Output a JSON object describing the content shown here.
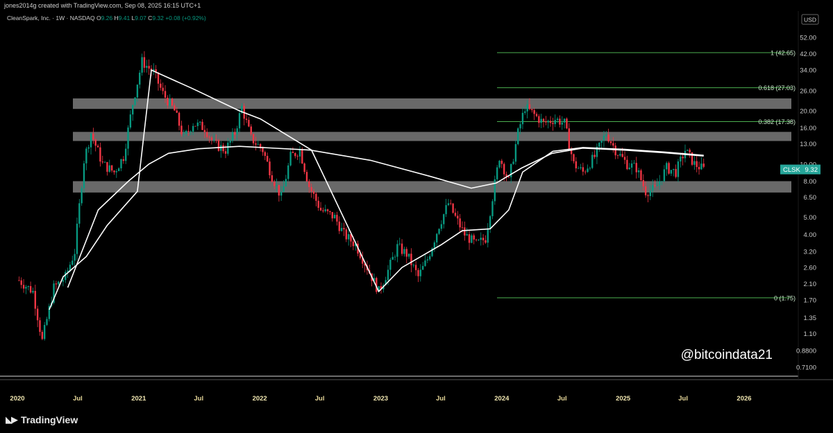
{
  "header": {
    "credit": "jones2014g created with TradingView.com, Sep 08, 2025 16:15 UTC+1"
  },
  "footer": {
    "brand": "TradingView"
  },
  "colors": {
    "up": "#089981",
    "down": "#f23645",
    "fib": "#4caf50",
    "ma": "#ffffff",
    "zone": "#8c8c8c",
    "price_badge": "#26a69a",
    "text": "#c9c9c9"
  },
  "chart_data": {
    "type": "candlestick",
    "symbol_line": "CleanSpark, Inc. · 1W · NASDAQ",
    "ohlc_legend": {
      "o_label": "O",
      "o": "9.26",
      "h_label": "H",
      "h": "9.41",
      "l_label": "L",
      "l": "9.07",
      "c_label": "C",
      "c": "9.32",
      "change": "+0.08 (+0.92%)"
    },
    "currency": "USD",
    "last_price": {
      "ticker": "CLSK",
      "value": "9.32"
    },
    "watermark": "@bitcoindata21",
    "y_scale": "log",
    "ylim": [
      0.66,
      72
    ],
    "y_ticks": [
      "52.00",
      "42.00",
      "34.00",
      "26.00",
      "20.00",
      "16.00",
      "13.00",
      "10.00",
      "8.00",
      "6.50",
      "5.00",
      "4.00",
      "3.20",
      "2.60",
      "2.10",
      "1.70",
      "1.35",
      "1.10",
      "0.8800",
      "0.7100"
    ],
    "x_ticks": [
      "2020",
      "Jul",
      "2021",
      "Jul",
      "2022",
      "Jul",
      "2023",
      "Jul",
      "2024",
      "Jul",
      "2025",
      "Jul",
      "2026"
    ],
    "fib_levels": [
      {
        "label": "1 (42.65)",
        "value": 42.65
      },
      {
        "label": "0.618 (27.03)",
        "value": 27.03
      },
      {
        "label": "0.382 (17.38)",
        "value": 17.38
      },
      {
        "label": "0 (1.75)",
        "value": 1.75
      }
    ],
    "zones": [
      {
        "low": 20.5,
        "high": 23.5
      },
      {
        "low": 13.5,
        "high": 15.2
      },
      {
        "low": 6.9,
        "high": 8.0
      }
    ],
    "price_anchors": [
      [
        "2020-01-06",
        2.2
      ],
      [
        "2020-02-17",
        1.9
      ],
      [
        "2020-03-16",
        1.0
      ],
      [
        "2020-04-20",
        2.0
      ],
      [
        "2020-05-25",
        2.3
      ],
      [
        "2020-06-22",
        3.2
      ],
      [
        "2020-07-20",
        10.5
      ],
      [
        "2020-08-10",
        15.0
      ],
      [
        "2020-09-14",
        10.0
      ],
      [
        "2020-10-19",
        9.0
      ],
      [
        "2020-11-16",
        11.0
      ],
      [
        "2020-12-14",
        22.0
      ],
      [
        "2021-01-11",
        38.0
      ],
      [
        "2021-02-15",
        33.0
      ],
      [
        "2021-03-15",
        25.0
      ],
      [
        "2021-04-19",
        20.0
      ],
      [
        "2021-05-17",
        14.0
      ],
      [
        "2021-06-14",
        17.0
      ],
      [
        "2021-07-19",
        16.0
      ],
      [
        "2021-08-16",
        13.0
      ],
      [
        "2021-09-20",
        12.0
      ],
      [
        "2021-10-18",
        15.0
      ],
      [
        "2021-11-08",
        21.0
      ],
      [
        "2021-12-06",
        14.0
      ],
      [
        "2022-01-10",
        12.0
      ],
      [
        "2022-02-07",
        8.5
      ],
      [
        "2022-03-07",
        6.5
      ],
      [
        "2022-04-04",
        11.0
      ],
      [
        "2022-05-02",
        12.0
      ],
      [
        "2022-05-30",
        7.5
      ],
      [
        "2022-07-04",
        5.5
      ],
      [
        "2022-08-15",
        5.0
      ],
      [
        "2022-09-12",
        4.0
      ],
      [
        "2022-10-17",
        3.5
      ],
      [
        "2022-11-21",
        2.6
      ],
      [
        "2022-12-26",
        1.9
      ],
      [
        "2023-01-23",
        2.5
      ],
      [
        "2023-02-20",
        3.4
      ],
      [
        "2023-03-20",
        3.1
      ],
      [
        "2023-04-24",
        2.3
      ],
      [
        "2023-05-22",
        2.9
      ],
      [
        "2023-06-26",
        4.5
      ],
      [
        "2023-07-24",
        6.0
      ],
      [
        "2023-08-14",
        5.0
      ],
      [
        "2023-09-11",
        4.0
      ],
      [
        "2023-10-16",
        3.5
      ],
      [
        "2023-11-13",
        3.8
      ],
      [
        "2023-12-04",
        6.5
      ],
      [
        "2023-12-25",
        11.0
      ],
      [
        "2024-01-22",
        8.0
      ],
      [
        "2024-02-19",
        15.0
      ],
      [
        "2024-03-11",
        21.0
      ],
      [
        "2024-04-08",
        19.0
      ],
      [
        "2024-05-06",
        17.0
      ],
      [
        "2024-06-10",
        18.0
      ],
      [
        "2024-07-08",
        17.0
      ],
      [
        "2024-08-05",
        10.0
      ],
      [
        "2024-09-02",
        9.0
      ],
      [
        "2024-10-07",
        11.0
      ],
      [
        "2024-11-11",
        15.0
      ],
      [
        "2024-12-09",
        12.0
      ],
      [
        "2025-01-13",
        10.0
      ],
      [
        "2025-02-10",
        9.5
      ],
      [
        "2025-03-10",
        7.0
      ],
      [
        "2025-04-07",
        7.2
      ],
      [
        "2025-05-12",
        9.5
      ],
      [
        "2025-06-09",
        9.0
      ],
      [
        "2025-07-07",
        12.0
      ],
      [
        "2025-08-04",
        10.0
      ],
      [
        "2025-09-01",
        9.32
      ]
    ],
    "ma_fast": [
      [
        "2020-06-01",
        2.0
      ],
      [
        "2020-09-01",
        5.5
      ],
      [
        "2020-12-01",
        8.0
      ],
      [
        "2021-02-01",
        10.0
      ],
      [
        "2021-04-01",
        11.5
      ],
      [
        "2021-07-01",
        12.2
      ],
      [
        "2021-11-01",
        12.6
      ],
      [
        "2022-06-01",
        12.0
      ],
      [
        "2022-12-01",
        10.5
      ],
      [
        "2023-06-01",
        8.5
      ],
      [
        "2023-10-01",
        7.3
      ],
      [
        "2023-12-15",
        7.8
      ],
      [
        "2024-03-01",
        9.5
      ],
      [
        "2024-06-01",
        11.5
      ],
      [
        "2024-09-01",
        12.3
      ],
      [
        "2025-01-01",
        12.0
      ],
      [
        "2025-05-01",
        11.6
      ],
      [
        "2025-09-01",
        11.1
      ]
    ],
    "ma_slow": [
      [
        "2020-04-06",
        1.5
      ],
      [
        "2020-05-18",
        2.3
      ],
      [
        "2020-07-27",
        3.0
      ],
      [
        "2020-09-28",
        4.5
      ],
      [
        "2020-12-28",
        7.0
      ],
      [
        "2021-02-08",
        34.0
      ],
      [
        "2021-06-07",
        27.0
      ],
      [
        "2021-11-01",
        20.0
      ],
      [
        "2022-01-03",
        18.0
      ],
      [
        "2022-06-06",
        12.0
      ],
      [
        "2022-12-26",
        1.9
      ],
      [
        "2023-03-06",
        2.6
      ],
      [
        "2023-07-03",
        3.5
      ],
      [
        "2023-09-04",
        4.2
      ],
      [
        "2023-11-27",
        4.3
      ],
      [
        "2024-01-22",
        5.5
      ],
      [
        "2024-03-04",
        9.0
      ],
      [
        "2024-06-03",
        11.8
      ],
      [
        "2024-09-02",
        12.4
      ],
      [
        "2025-01-06",
        12.1
      ],
      [
        "2025-05-05",
        11.7
      ],
      [
        "2025-09-01",
        11.2
      ]
    ]
  }
}
